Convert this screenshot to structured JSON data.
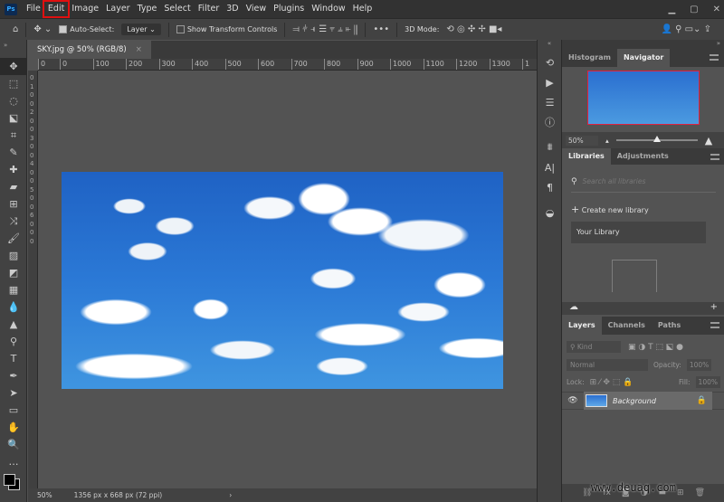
{
  "menubar": {
    "logo": "Ps",
    "items": [
      "File",
      "Edit",
      "Image",
      "Layer",
      "Type",
      "Select",
      "Filter",
      "3D",
      "View",
      "Plugins",
      "Window",
      "Help"
    ],
    "highlighted": "Edit",
    "window_controls": [
      "minimize",
      "restore",
      "close"
    ]
  },
  "options": {
    "auto_select_label": "Auto-Select:",
    "auto_select_checked": true,
    "layer_select": "Layer",
    "show_transform_label": "Show Transform Controls",
    "show_transform_checked": false,
    "mode_label": "3D Mode:"
  },
  "document": {
    "tab_title": "SKY.jpg @ 50% (RGB/8)",
    "ruler_ticks": [
      "0",
      "0",
      "100",
      "200",
      "300",
      "400",
      "500",
      "600",
      "700",
      "800",
      "900",
      "1000",
      "1100",
      "1200",
      "1300",
      "1"
    ],
    "vruler_ticks": [
      "0",
      "1",
      "0",
      "0",
      "2",
      "0",
      "0",
      "3",
      "0",
      "0",
      "4",
      "0",
      "0",
      "5",
      "0",
      "0",
      "6",
      "0",
      "0",
      "0"
    ]
  },
  "status": {
    "zoom": "50%",
    "info": "1356 px x 668 px (72 ppi)",
    "arrow": "›"
  },
  "navigator": {
    "tabs": [
      "Histogram",
      "Navigator"
    ],
    "active": "Navigator",
    "zoom": "50%",
    "slider_fraction": 0.5
  },
  "libraries": {
    "tabs": [
      "Libraries",
      "Adjustments"
    ],
    "active": "Libraries",
    "search_placeholder": "Search all libraries",
    "create_label": "Create new library",
    "library_name": "Your Library"
  },
  "layers": {
    "tabs": [
      "Layers",
      "Channels",
      "Paths"
    ],
    "active": "Layers",
    "kind_placeholder": "Kind",
    "blend_mode": "Normal",
    "opacity_label": "Opacity:",
    "opacity": "100%",
    "lock_label": "Lock:",
    "fill_label": "Fill:",
    "fill": "100%",
    "items": [
      {
        "name": "Background",
        "visible": true,
        "locked": true
      }
    ]
  },
  "colors": {
    "highlight": "#e01010",
    "canvas_bg": "#535353",
    "panel_bg": "#424242"
  },
  "watermark": "www.deuaq.com"
}
